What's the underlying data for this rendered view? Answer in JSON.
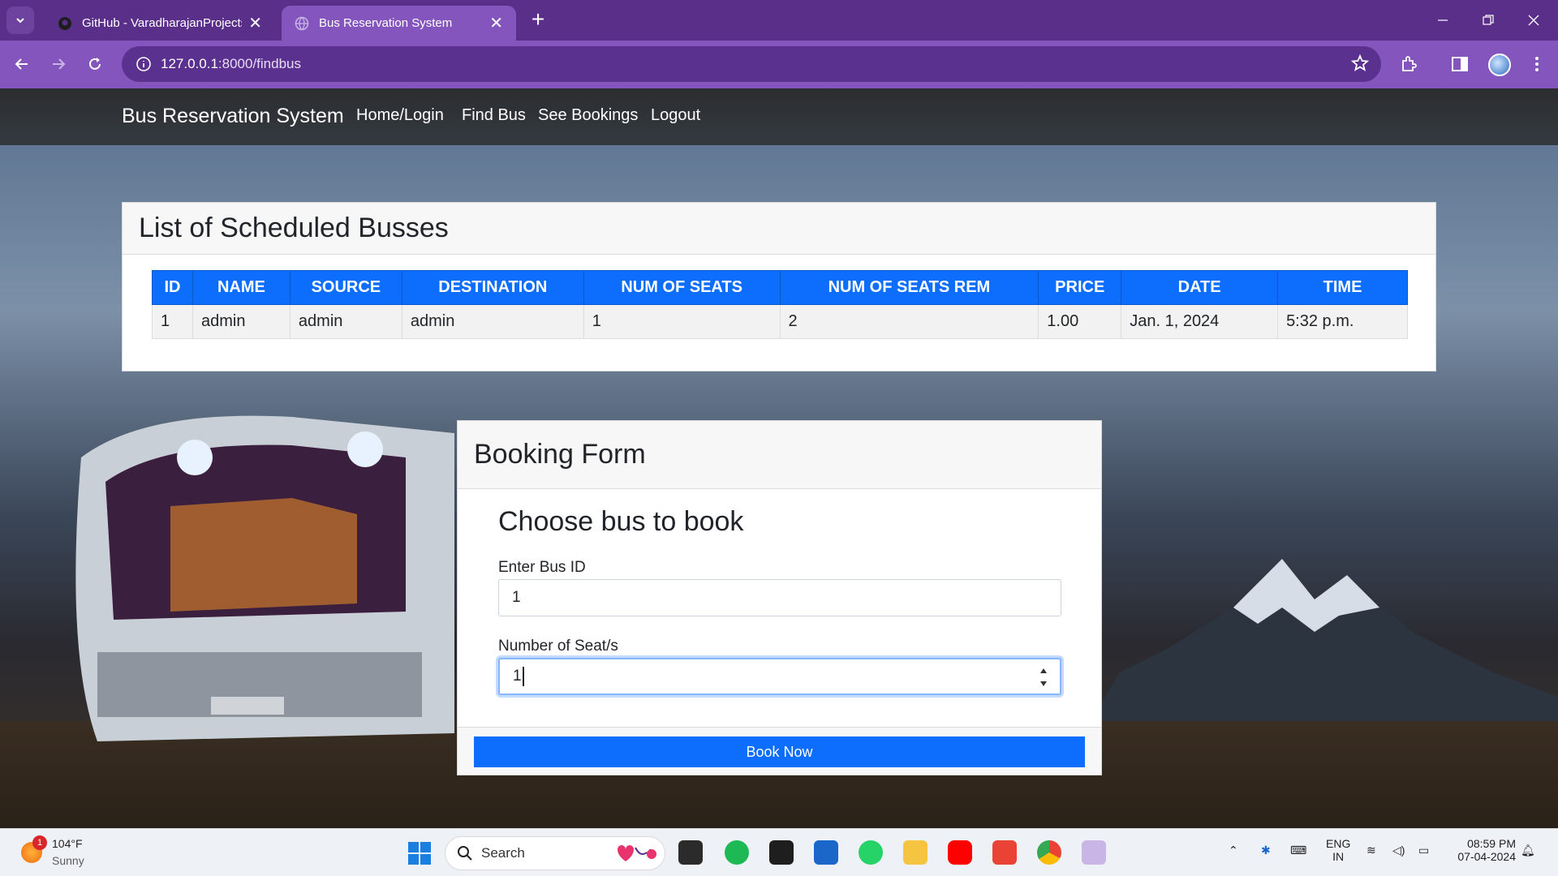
{
  "browser": {
    "tabs": [
      {
        "title": "GitHub - VaradharajanProjects/",
        "active": false
      },
      {
        "title": "Bus Reservation System",
        "active": true
      }
    ],
    "new_tab": "+",
    "url_host": "127.0.0.1",
    "url_path": ":8000/findbus"
  },
  "navbar": {
    "brand": "Bus Reservation System",
    "links": [
      "Home/Login",
      "Find Bus",
      "See Bookings",
      "Logout"
    ]
  },
  "schedule": {
    "title": "List of Scheduled Busses",
    "columns": [
      "ID",
      "NAME",
      "SOURCE",
      "DESTINATION",
      "NUM OF SEATS",
      "NUM OF SEATS REM",
      "PRICE",
      "DATE",
      "TIME"
    ],
    "rows": [
      [
        "1",
        "admin",
        "admin",
        "admin",
        "1",
        "2",
        "1.00",
        "Jan. 1, 2024",
        "5:32 p.m."
      ]
    ]
  },
  "booking": {
    "title": "Booking Form",
    "subtitle": "Choose bus to book",
    "bus_id_label": "Enter Bus ID",
    "bus_id_value": "1",
    "seats_label": "Number of Seat/s",
    "seats_value": "1",
    "submit_label": "Book Now"
  },
  "taskbar": {
    "weather_badge": "1",
    "weather_temp": "104°F",
    "weather_desc": "Sunny",
    "search_label": "Search",
    "lang_top": "ENG",
    "lang_bottom": "IN",
    "time": "08:59 PM",
    "date": "07-04-2024"
  },
  "colors": {
    "browser_frame": "#5a2f8a",
    "browser_toolbar": "#8456bd",
    "primary": "#0d6efd",
    "navbar": "#343a40"
  }
}
